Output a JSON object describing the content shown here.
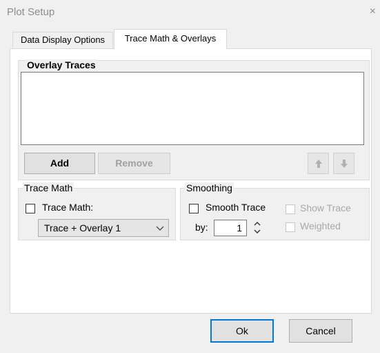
{
  "window": {
    "title": "Plot Setup",
    "close_glyph": "×"
  },
  "tabs": [
    {
      "label": "Data Display Options",
      "active": false
    },
    {
      "label": "Trace Math & Overlays",
      "active": true
    }
  ],
  "overlay": {
    "group_title": "Overlay Traces",
    "items": [],
    "add_label": "Add",
    "remove_label": "Remove",
    "up_icon": "arrow-up-icon",
    "down_icon": "arrow-down-icon"
  },
  "trace_math": {
    "group_title": "Trace Math",
    "checkbox_label": "Trace Math:",
    "checked": false,
    "select_value": "Trace + Overlay 1"
  },
  "smoothing": {
    "group_title": "Smoothing",
    "smooth_label": "Smooth Trace",
    "smooth_checked": false,
    "by_label": "by:",
    "by_value": "1",
    "show_trace_label": "Show Trace",
    "weighted_label": "Weighted"
  },
  "dialog_buttons": {
    "ok": "Ok",
    "cancel": "Cancel"
  }
}
